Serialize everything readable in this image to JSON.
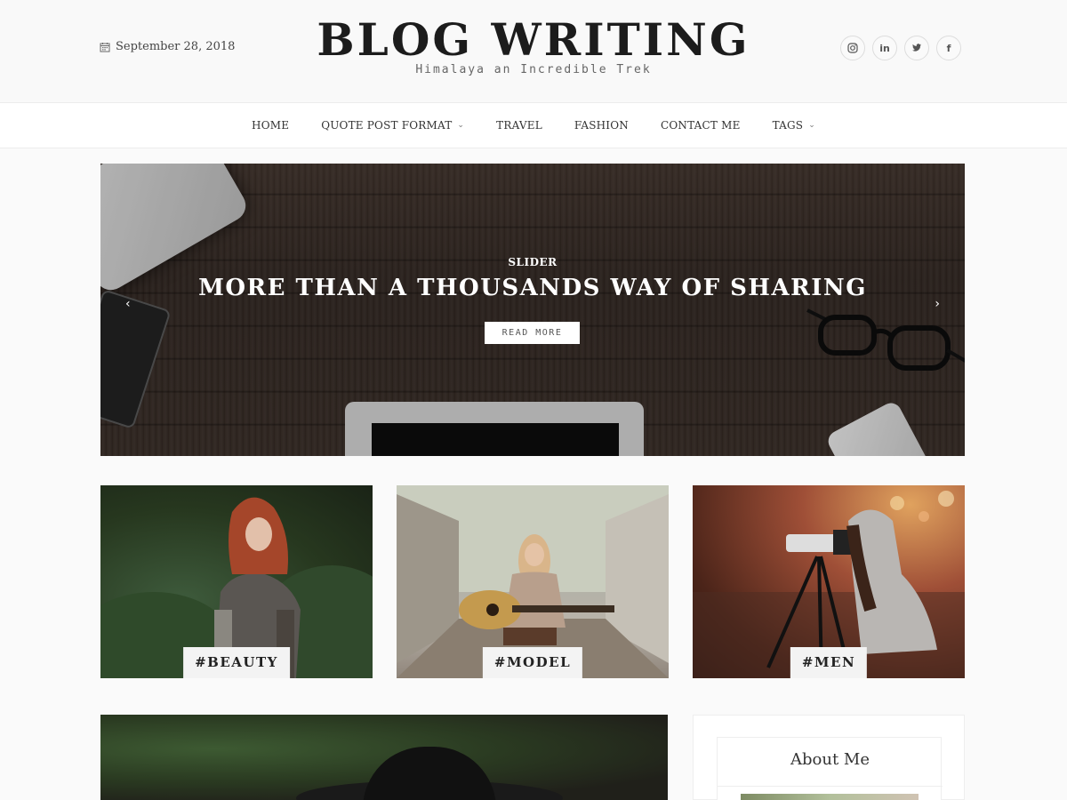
{
  "header": {
    "date": "September 28, 2018",
    "site_title": "BLOG WRITING",
    "tagline": "Himalaya an Incredible Trek",
    "socials": [
      "instagram",
      "in",
      "twitter",
      "f"
    ]
  },
  "nav": {
    "items": [
      {
        "label": "HOME",
        "dropdown": false
      },
      {
        "label": "QUOTE POST FORMAT",
        "dropdown": true
      },
      {
        "label": "TRAVEL",
        "dropdown": false
      },
      {
        "label": "FASHION",
        "dropdown": false
      },
      {
        "label": "CONTACT ME",
        "dropdown": false
      },
      {
        "label": "TAGS",
        "dropdown": true
      }
    ]
  },
  "slider": {
    "label": "SLIDER",
    "title": "MORE THAN A THOUSANDS WAY OF SHARING",
    "button": "READ MORE",
    "prev": "‹",
    "next": "›"
  },
  "cards": [
    {
      "tag": "#BEAUTY"
    },
    {
      "tag": "#MODEL"
    },
    {
      "tag": "#MEN"
    }
  ],
  "sidebar": {
    "about_title": "About Me"
  },
  "colors": {
    "accent": "#1c1c1c",
    "nav_bg": "#ffffff",
    "page_bg": "#fafafa"
  }
}
